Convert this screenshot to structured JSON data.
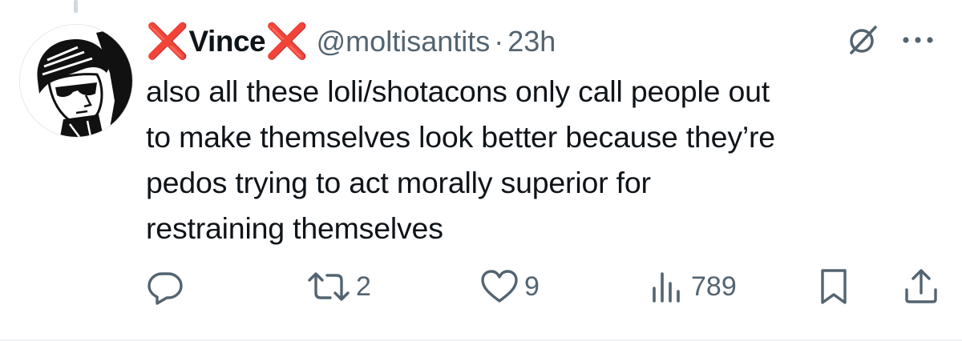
{
  "author": {
    "name_prefix": "❌",
    "display_name": "Vince",
    "name_suffix": "❌",
    "handle": "@moltisantits",
    "separator": "·",
    "time": "23h"
  },
  "tweet": {
    "lines": [
      "also all these loli/shotacons only call people out",
      "to make themselves look better because they’re",
      "pedos trying to act morally superior for",
      "restraining themselves"
    ]
  },
  "actions": {
    "reply": {
      "icon": "reply-icon",
      "count": ""
    },
    "retweet": {
      "icon": "retweet-icon",
      "count": "2"
    },
    "like": {
      "icon": "heart-icon",
      "count": "9"
    },
    "views": {
      "icon": "views-icon",
      "count": "789"
    },
    "bookmark": {
      "icon": "bookmark-icon"
    },
    "share": {
      "icon": "share-icon"
    }
  },
  "colors": {
    "text": "#0f1419",
    "secondary": "#536471",
    "x_mark": "#dd2e2e",
    "divider": "#eff3f4"
  }
}
